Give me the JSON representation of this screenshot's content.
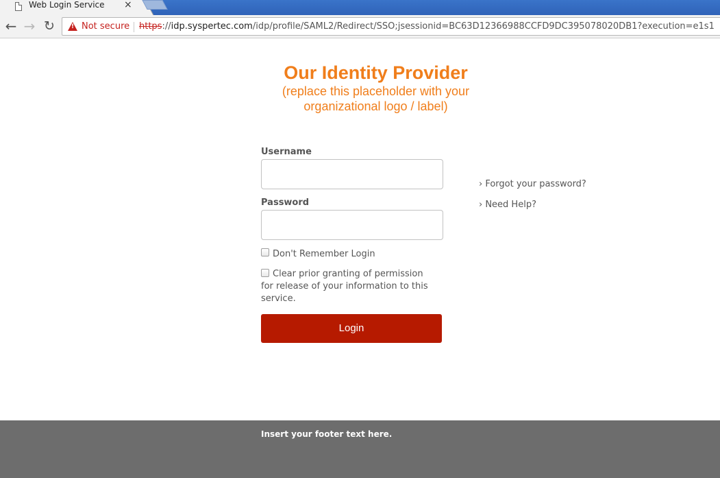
{
  "browser": {
    "tab": {
      "title": "Web Login Service",
      "close_glyph": "×",
      "icon": "page-icon"
    },
    "nav": {
      "back_glyph": "←",
      "forward_glyph": "→",
      "reload_glyph": "↻"
    },
    "address_bar": {
      "security_label": "Not secure",
      "warning_glyph": "!",
      "url_scheme": "https",
      "url_separator": "://",
      "url_host": "idp.syspertec.com",
      "url_path": "/idp/profile/SAML2/Redirect/SSO;jsessionid=BC63D12366988CCFD9DC395078020DB1?execution=e1s1"
    }
  },
  "header": {
    "title": "Our Identity Provider",
    "subtitle_line1": "(replace this placeholder with your",
    "subtitle_line2": "organizational logo / label)"
  },
  "form": {
    "username_label": "Username",
    "username_value": "",
    "password_label": "Password",
    "password_value": "",
    "dont_remember_label": "Don't Remember Login",
    "clear_consent_label": "Clear prior granting of permission for release of your information to this service.",
    "login_button": "Login"
  },
  "side_links": {
    "forgot_password": "› Forgot your password?",
    "need_help": "› Need Help?"
  },
  "footer": {
    "text": "Insert your footer text here."
  },
  "colors": {
    "brand_orange": "#f07e1b",
    "login_button": "#b61a00",
    "footer_bg": "#6d6d6d",
    "insecure_red": "#c5221f"
  }
}
